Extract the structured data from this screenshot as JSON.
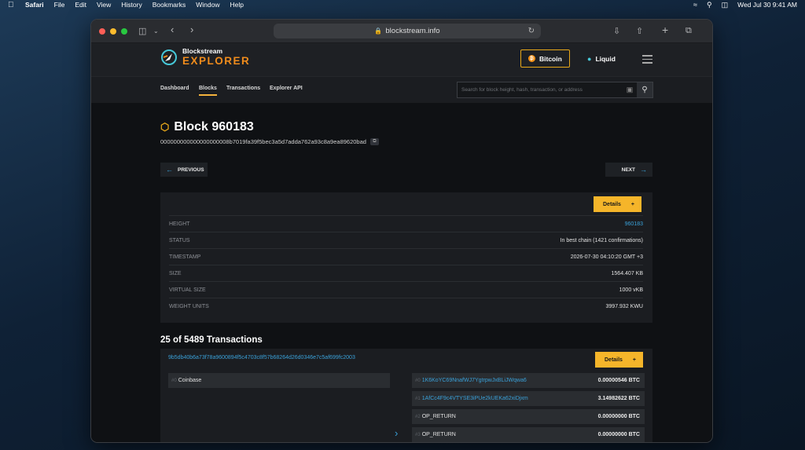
{
  "menubar": {
    "apple": "",
    "app": "Safari",
    "menus": [
      "File",
      "Edit",
      "View",
      "History",
      "Bookmarks",
      "Window",
      "Help"
    ],
    "datetime": "Wed Jul 30  9:41 AM"
  },
  "browser": {
    "url": "blockstream.info"
  },
  "site": {
    "logo_small": "Blockstream",
    "logo_big": "EXPLORER",
    "network_bitcoin": "Bitcoin",
    "network_liquid": "Liquid",
    "nav": [
      "Dashboard",
      "Blocks",
      "Transactions",
      "Explorer API"
    ],
    "active_nav": "Blocks",
    "search_placeholder": "Search for block height, hash, transaction, or address"
  },
  "block": {
    "title": "Block 960183",
    "hash": "000000000000000000008b7019fa39f5bec3a5d7adda762a93c8a9ea89620bad",
    "prev_label": "PREVIOUS",
    "next_label": "NEXT",
    "details_label": "Details",
    "rows": [
      {
        "key": "HEIGHT",
        "value": "960183"
      },
      {
        "key": "STATUS",
        "value": "In best chain (1421 confirmations)"
      },
      {
        "key": "TIMESTAMP",
        "value": "2026-07-30 04:10:20 GMT +3"
      },
      {
        "key": "SIZE",
        "value": "1564.407 KB"
      },
      {
        "key": "VIRTUAL SIZE",
        "value": "1000 vKB"
      },
      {
        "key": "WEIGHT UNITS",
        "value": "3997.932 KWU"
      }
    ]
  },
  "transactions": {
    "heading": "25 of 5489 Transactions",
    "tx_hash": "9b5db40b6a73f78a9600894f5c4703c8f57b68264d26d0346e7c5af699fc2003",
    "details_label": "Details",
    "inputs": [
      {
        "index": "#0",
        "label": "Coinbase"
      }
    ],
    "outputs": [
      {
        "index": "#0",
        "address": "1K6KoYC69NnafWJ7YgtrpwJxBLiJWqwa6",
        "amount": "0.00000546 BTC"
      },
      {
        "index": "#1",
        "address": "1AfCc4F9c4VTYSE3iPUe2kUEKa62xiDjxm",
        "amount": "3.14982622 BTC"
      },
      {
        "index": "#2",
        "address": "OP_RETURN",
        "amount": "0.00000000 BTC"
      },
      {
        "index": "#3",
        "address": "OP_RETURN",
        "amount": "0.00000000 BTC"
      }
    ]
  }
}
